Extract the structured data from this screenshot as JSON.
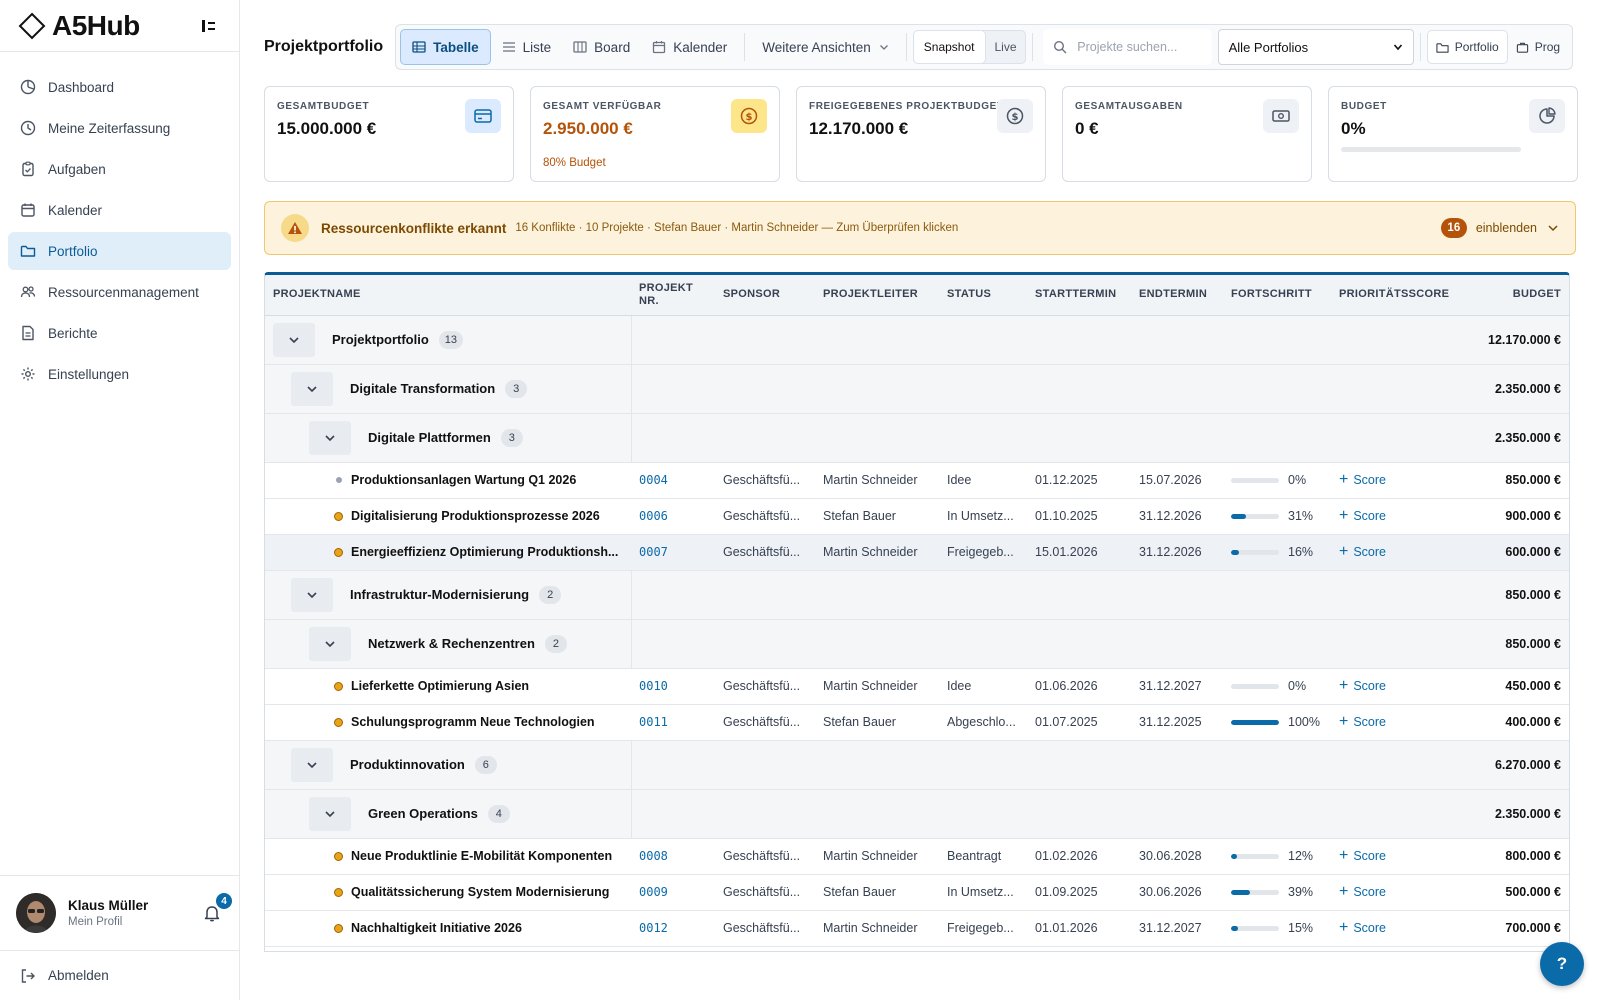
{
  "app": {
    "name": "A5Hub"
  },
  "sidebar": {
    "items": [
      {
        "label": "Dashboard",
        "icon": "dashboard-icon"
      },
      {
        "label": "Meine Zeiterfassung",
        "icon": "clock-icon"
      },
      {
        "label": "Aufgaben",
        "icon": "clipboard-icon"
      },
      {
        "label": "Kalender",
        "icon": "calendar-icon"
      },
      {
        "label": "Portfolio",
        "icon": "folder-icon",
        "active": true
      },
      {
        "label": "Ressourcenmanagement",
        "icon": "users-icon"
      },
      {
        "label": "Berichte",
        "icon": "report-icon"
      },
      {
        "label": "Einstellungen",
        "icon": "settings-icon"
      }
    ],
    "user": {
      "name": "Klaus Müller",
      "subtitle": "Mein Profil",
      "notifications": "4"
    },
    "logout": "Abmelden"
  },
  "header": {
    "title": "Projektportfolio",
    "views": [
      "Tabelle",
      "Liste",
      "Board",
      "Kalender"
    ],
    "more_views": "Weitere Ansichten",
    "mode": {
      "snapshot": "Snapshot",
      "live": "Live"
    },
    "search_placeholder": "Projekte suchen...",
    "portfolio_select": "Alle Portfolios",
    "scope": {
      "portfolio": "Portfolio",
      "program": "Prog"
    }
  },
  "kpis": [
    {
      "label": "GESAMTBUDGET",
      "value": "15.000.000 €",
      "icon": "credit-card-icon"
    },
    {
      "label": "GESAMT VERFÜGBAR",
      "value": "2.950.000 €",
      "sub": "80% Budget",
      "icon": "dollar-coin-icon"
    },
    {
      "label": "FREIGEGEBENES PROJEKTBUDGET",
      "value": "12.170.000 €",
      "icon": "dollar-circle-icon"
    },
    {
      "label": "GESAMTAUSGABEN",
      "value": "0 €",
      "icon": "cash-icon"
    },
    {
      "label": "BUDGET",
      "value": "0%",
      "progress": 0,
      "icon": "pie-chart-icon"
    }
  ],
  "alert": {
    "title": "Ressourcenkonflikte erkannt",
    "text": "16 Konflikte · 10 Projekte · Stefan Bauer · Martin Schneider — Zum Überprüfen klicken",
    "count": "16",
    "action": "einblenden"
  },
  "table": {
    "columns": [
      "PROJEKTNAME",
      "PROJEKT NR.",
      "SPONSOR",
      "PROJEKTLEITER",
      "STATUS",
      "STARTTERMIN",
      "ENDTERMIN",
      "FORTSCHRITT",
      "PRIORITÄTSSCORE",
      "BUDGET"
    ],
    "score_label": "Score",
    "rows": [
      {
        "type": "group",
        "level": 0,
        "name": "Projektportfolio",
        "count": "13",
        "budget": "12.170.000 €"
      },
      {
        "type": "group",
        "level": 1,
        "name": "Digitale Transformation",
        "count": "3",
        "budget": "2.350.000 €"
      },
      {
        "type": "group",
        "level": 2,
        "name": "Digitale Plattformen",
        "count": "3",
        "budget": "2.350.000 €"
      },
      {
        "type": "project",
        "name": "Produktionsanlagen Wartung Q1 2026",
        "dot": "grey",
        "nr": "0004",
        "sponsor": "Geschäftsfü...",
        "lead": "Martin Schneider",
        "status": "Idee",
        "start": "01.12.2025",
        "end": "15.07.2026",
        "progress": 0,
        "progress_label": "0%",
        "budget": "850.000 €"
      },
      {
        "type": "project",
        "name": "Digitalisierung Produktionsprozesse 2026",
        "dot": "orange",
        "nr": "0006",
        "sponsor": "Geschäftsfü...",
        "lead": "Stefan Bauer",
        "status": "In Umsetz...",
        "start": "01.10.2025",
        "end": "31.12.2026",
        "progress": 31,
        "progress_label": "31%",
        "budget": "900.000 €"
      },
      {
        "type": "project",
        "name": "Energieeffizienz Optimierung Produktionsh...",
        "dot": "orange",
        "nr": "0007",
        "sponsor": "Geschäftsfü...",
        "lead": "Martin Schneider",
        "status": "Freigegeb...",
        "start": "15.01.2026",
        "end": "31.12.2026",
        "progress": 16,
        "progress_label": "16%",
        "budget": "600.000 €",
        "highlight": true
      },
      {
        "type": "group",
        "level": 1,
        "name": "Infrastruktur-Modernisierung",
        "count": "2",
        "budget": "850.000 €"
      },
      {
        "type": "group",
        "level": 2,
        "name": "Netzwerk & Rechenzentren",
        "count": "2",
        "budget": "850.000 €"
      },
      {
        "type": "project",
        "name": "Lieferkette Optimierung Asien",
        "dot": "orange",
        "nr": "0010",
        "sponsor": "Geschäftsfü...",
        "lead": "Martin Schneider",
        "status": "Idee",
        "start": "01.06.2026",
        "end": "31.12.2027",
        "progress": 0,
        "progress_label": "0%",
        "budget": "450.000 €"
      },
      {
        "type": "project",
        "name": "Schulungsprogramm Neue Technologien",
        "dot": "orange",
        "nr": "0011",
        "sponsor": "Geschäftsfü...",
        "lead": "Stefan Bauer",
        "status": "Abgeschlo...",
        "start": "01.07.2025",
        "end": "31.12.2025",
        "progress": 100,
        "progress_label": "100%",
        "budget": "400.000 €"
      },
      {
        "type": "group",
        "level": 1,
        "name": "Produktinnovation",
        "count": "6",
        "budget": "6.270.000 €"
      },
      {
        "type": "group",
        "level": 2,
        "name": "Green Operations",
        "count": "4",
        "budget": "2.350.000 €"
      },
      {
        "type": "project",
        "name": "Neue Produktlinie E-Mobilität Komponenten",
        "dot": "orange",
        "nr": "0008",
        "sponsor": "Geschäftsfü...",
        "lead": "Martin Schneider",
        "status": "Beantragt",
        "start": "01.02.2026",
        "end": "30.06.2028",
        "progress": 12,
        "progress_label": "12%",
        "budget": "800.000 €"
      },
      {
        "type": "project",
        "name": "Qualitätssicherung System Modernisierung",
        "dot": "orange",
        "nr": "0009",
        "sponsor": "Geschäftsfü...",
        "lead": "Stefan Bauer",
        "status": "In Umsetz...",
        "start": "01.09.2025",
        "end": "30.06.2026",
        "progress": 39,
        "progress_label": "39%",
        "budget": "500.000 €"
      },
      {
        "type": "project",
        "name": "Nachhaltigkeit Initiative 2026",
        "dot": "orange",
        "nr": "0012",
        "sponsor": "Geschäftsfü...",
        "lead": "Martin Schneider",
        "status": "Freigegeb...",
        "start": "01.01.2026",
        "end": "31.12.2027",
        "progress": 15,
        "progress_label": "15%",
        "budget": "700.000 €"
      }
    ]
  },
  "help": "?"
}
